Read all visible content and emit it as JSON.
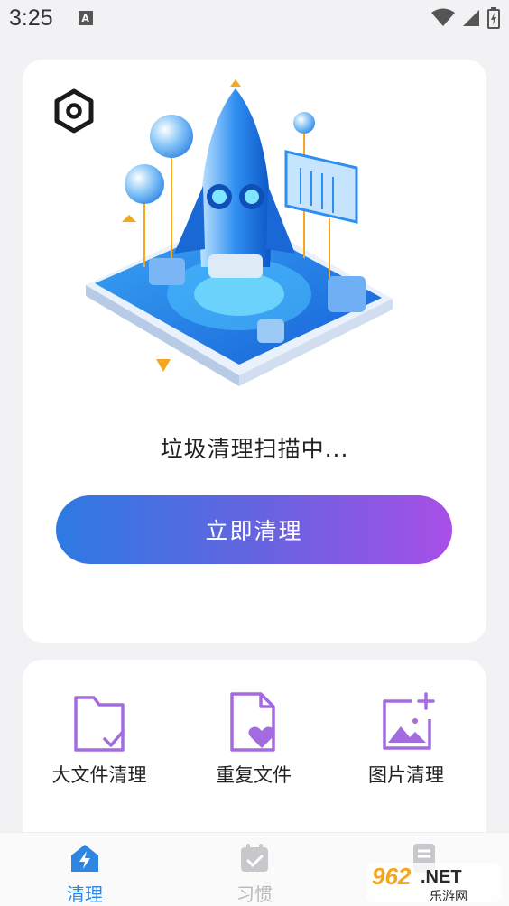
{
  "status_bar": {
    "time": "3:25",
    "notif_letter": "A",
    "icons": [
      "wifi-icon",
      "signal-icon",
      "battery-icon"
    ]
  },
  "hero": {
    "settings_icon": "settings-hexagon-icon",
    "illustration": "rocket-illustration",
    "scan_text": "垃圾清理扫描中...",
    "clean_button": "立即清理"
  },
  "tools": [
    {
      "label": "大文件清理",
      "icon": "folder-check-icon"
    },
    {
      "label": "重复文件",
      "icon": "file-heart-icon"
    },
    {
      "label": "图片清理",
      "icon": "image-plus-icon"
    }
  ],
  "nav": [
    {
      "label": "清理",
      "icon": "home-bolt-icon",
      "active": true
    },
    {
      "label": "习惯",
      "icon": "calendar-check-icon",
      "active": false
    },
    {
      "label": "",
      "icon": "document-icon",
      "active": false
    }
  ],
  "watermark": {
    "brand": "962.NET",
    "sub": "乐游网"
  },
  "colors": {
    "accent_purple": "#a36be0",
    "accent_blue": "#2d7ae2",
    "active_nav": "#2f86e0",
    "inactive_nav": "#b9b9bd"
  }
}
